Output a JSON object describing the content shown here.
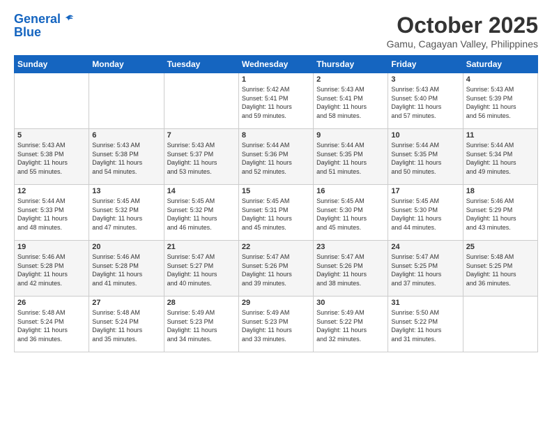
{
  "header": {
    "logo_line1": "General",
    "logo_line2": "Blue",
    "month": "October 2025",
    "location": "Gamu, Cagayan Valley, Philippines"
  },
  "weekdays": [
    "Sunday",
    "Monday",
    "Tuesday",
    "Wednesday",
    "Thursday",
    "Friday",
    "Saturday"
  ],
  "weeks": [
    [
      {
        "day": "",
        "info": ""
      },
      {
        "day": "",
        "info": ""
      },
      {
        "day": "",
        "info": ""
      },
      {
        "day": "1",
        "info": "Sunrise: 5:42 AM\nSunset: 5:41 PM\nDaylight: 11 hours\nand 59 minutes."
      },
      {
        "day": "2",
        "info": "Sunrise: 5:43 AM\nSunset: 5:41 PM\nDaylight: 11 hours\nand 58 minutes."
      },
      {
        "day": "3",
        "info": "Sunrise: 5:43 AM\nSunset: 5:40 PM\nDaylight: 11 hours\nand 57 minutes."
      },
      {
        "day": "4",
        "info": "Sunrise: 5:43 AM\nSunset: 5:39 PM\nDaylight: 11 hours\nand 56 minutes."
      }
    ],
    [
      {
        "day": "5",
        "info": "Sunrise: 5:43 AM\nSunset: 5:38 PM\nDaylight: 11 hours\nand 55 minutes."
      },
      {
        "day": "6",
        "info": "Sunrise: 5:43 AM\nSunset: 5:38 PM\nDaylight: 11 hours\nand 54 minutes."
      },
      {
        "day": "7",
        "info": "Sunrise: 5:43 AM\nSunset: 5:37 PM\nDaylight: 11 hours\nand 53 minutes."
      },
      {
        "day": "8",
        "info": "Sunrise: 5:44 AM\nSunset: 5:36 PM\nDaylight: 11 hours\nand 52 minutes."
      },
      {
        "day": "9",
        "info": "Sunrise: 5:44 AM\nSunset: 5:35 PM\nDaylight: 11 hours\nand 51 minutes."
      },
      {
        "day": "10",
        "info": "Sunrise: 5:44 AM\nSunset: 5:35 PM\nDaylight: 11 hours\nand 50 minutes."
      },
      {
        "day": "11",
        "info": "Sunrise: 5:44 AM\nSunset: 5:34 PM\nDaylight: 11 hours\nand 49 minutes."
      }
    ],
    [
      {
        "day": "12",
        "info": "Sunrise: 5:44 AM\nSunset: 5:33 PM\nDaylight: 11 hours\nand 48 minutes."
      },
      {
        "day": "13",
        "info": "Sunrise: 5:45 AM\nSunset: 5:32 PM\nDaylight: 11 hours\nand 47 minutes."
      },
      {
        "day": "14",
        "info": "Sunrise: 5:45 AM\nSunset: 5:32 PM\nDaylight: 11 hours\nand 46 minutes."
      },
      {
        "day": "15",
        "info": "Sunrise: 5:45 AM\nSunset: 5:31 PM\nDaylight: 11 hours\nand 45 minutes."
      },
      {
        "day": "16",
        "info": "Sunrise: 5:45 AM\nSunset: 5:30 PM\nDaylight: 11 hours\nand 45 minutes."
      },
      {
        "day": "17",
        "info": "Sunrise: 5:45 AM\nSunset: 5:30 PM\nDaylight: 11 hours\nand 44 minutes."
      },
      {
        "day": "18",
        "info": "Sunrise: 5:46 AM\nSunset: 5:29 PM\nDaylight: 11 hours\nand 43 minutes."
      }
    ],
    [
      {
        "day": "19",
        "info": "Sunrise: 5:46 AM\nSunset: 5:28 PM\nDaylight: 11 hours\nand 42 minutes."
      },
      {
        "day": "20",
        "info": "Sunrise: 5:46 AM\nSunset: 5:28 PM\nDaylight: 11 hours\nand 41 minutes."
      },
      {
        "day": "21",
        "info": "Sunrise: 5:47 AM\nSunset: 5:27 PM\nDaylight: 11 hours\nand 40 minutes."
      },
      {
        "day": "22",
        "info": "Sunrise: 5:47 AM\nSunset: 5:26 PM\nDaylight: 11 hours\nand 39 minutes."
      },
      {
        "day": "23",
        "info": "Sunrise: 5:47 AM\nSunset: 5:26 PM\nDaylight: 11 hours\nand 38 minutes."
      },
      {
        "day": "24",
        "info": "Sunrise: 5:47 AM\nSunset: 5:25 PM\nDaylight: 11 hours\nand 37 minutes."
      },
      {
        "day": "25",
        "info": "Sunrise: 5:48 AM\nSunset: 5:25 PM\nDaylight: 11 hours\nand 36 minutes."
      }
    ],
    [
      {
        "day": "26",
        "info": "Sunrise: 5:48 AM\nSunset: 5:24 PM\nDaylight: 11 hours\nand 36 minutes."
      },
      {
        "day": "27",
        "info": "Sunrise: 5:48 AM\nSunset: 5:24 PM\nDaylight: 11 hours\nand 35 minutes."
      },
      {
        "day": "28",
        "info": "Sunrise: 5:49 AM\nSunset: 5:23 PM\nDaylight: 11 hours\nand 34 minutes."
      },
      {
        "day": "29",
        "info": "Sunrise: 5:49 AM\nSunset: 5:23 PM\nDaylight: 11 hours\nand 33 minutes."
      },
      {
        "day": "30",
        "info": "Sunrise: 5:49 AM\nSunset: 5:22 PM\nDaylight: 11 hours\nand 32 minutes."
      },
      {
        "day": "31",
        "info": "Sunrise: 5:50 AM\nSunset: 5:22 PM\nDaylight: 11 hours\nand 31 minutes."
      },
      {
        "day": "",
        "info": ""
      }
    ]
  ]
}
